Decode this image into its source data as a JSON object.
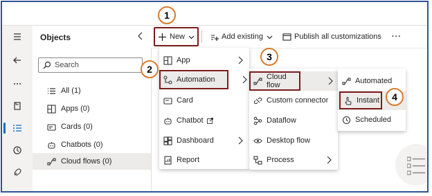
{
  "objects": {
    "title": "Objects",
    "search_placeholder": "Search",
    "items": [
      {
        "label": "All (1)",
        "icon": "list-icon"
      },
      {
        "label": "Apps (0)",
        "icon": "apps-icon"
      },
      {
        "label": "Cards (0)",
        "icon": "card-icon"
      },
      {
        "label": "Chatbots (0)",
        "icon": "chatbot-icon"
      },
      {
        "label": "Cloud flows (0)",
        "icon": "flow-icon",
        "selected": true
      }
    ]
  },
  "cmdbar": {
    "new_label": "New",
    "add_existing_label": "Add existing",
    "publish_label": "Publish all customizations",
    "more_label": "···"
  },
  "new_menu": [
    {
      "label": "App",
      "submenu": true
    },
    {
      "label": "Automation",
      "submenu": true,
      "highlighted": true
    },
    {
      "label": "Card",
      "submenu": false
    },
    {
      "label": "Chatbot",
      "submenu": false,
      "external": true
    },
    {
      "label": "Dashboard",
      "submenu": true
    },
    {
      "label": "Report",
      "submenu": false
    }
  ],
  "automation_menu": [
    {
      "label": "Cloud flow",
      "submenu": true,
      "highlighted": true
    },
    {
      "label": "Custom connector",
      "submenu": false
    },
    {
      "label": "Dataflow",
      "submenu": false
    },
    {
      "label": "Desktop flow",
      "submenu": false
    },
    {
      "label": "Process",
      "submenu": true
    }
  ],
  "cloud_flow_menu": [
    {
      "label": "Automated"
    },
    {
      "label": "Instant",
      "highlighted": true
    },
    {
      "label": "Scheduled"
    }
  ],
  "callouts": [
    "1",
    "2",
    "3",
    "4"
  ],
  "colors": {
    "accent": "#0f6cbd",
    "callout_border": "#d97b2b",
    "box_border": "#7b1c1c",
    "frame": "#2f5496"
  }
}
